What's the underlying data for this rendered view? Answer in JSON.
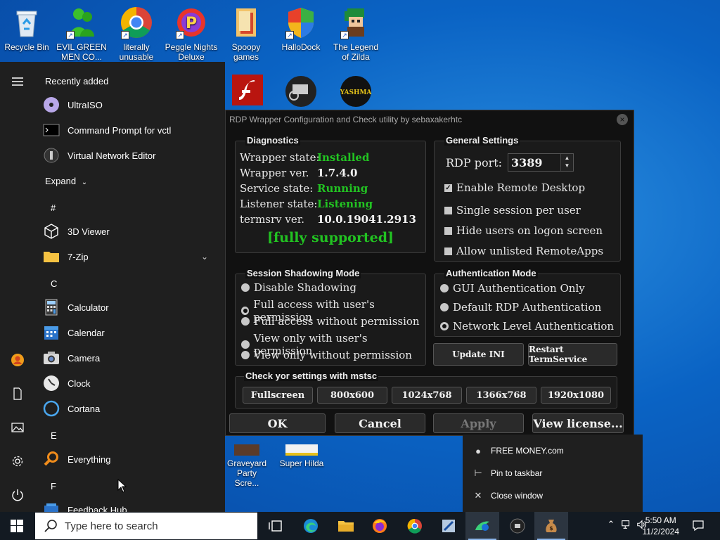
{
  "desktop": {
    "icons": [
      {
        "label": "Recycle Bin"
      },
      {
        "label": "EVIL GREEN MEN CO..."
      },
      {
        "label": "literally unusable"
      },
      {
        "label": "Peggle Nights Deluxe"
      },
      {
        "label": "Spoopy games"
      },
      {
        "label": "HalloDock"
      },
      {
        "label": "The Legend of Zilda"
      }
    ],
    "lower_icons": [
      {
        "label": "Graveyard Party Scre..."
      },
      {
        "label": "Super Hilda"
      }
    ]
  },
  "start_menu": {
    "recently_added_heading": "Recently added",
    "recent": [
      {
        "label": "UltraISO"
      },
      {
        "label": "Command Prompt for vctl"
      },
      {
        "label": "Virtual Network Editor"
      }
    ],
    "expand_label": "Expand",
    "letters": [
      "#",
      "C",
      "E",
      "F"
    ],
    "apps": [
      {
        "label": "3D Viewer"
      },
      {
        "label": "7-Zip"
      },
      {
        "label": "Calculator"
      },
      {
        "label": "Calendar"
      },
      {
        "label": "Camera"
      },
      {
        "label": "Clock"
      },
      {
        "label": "Cortana"
      },
      {
        "label": "Everything"
      },
      {
        "label": "Feedback Hub"
      }
    ]
  },
  "rdp": {
    "title": "RDP Wrapper Configuration and Check utility by sebaxakerhtc",
    "close_glyph": "×",
    "diagnostics": {
      "title": "Diagnostics",
      "rows": [
        {
          "label": "Wrapper state:",
          "value": "Installed"
        },
        {
          "label": "Wrapper ver.",
          "value": "1.7.4.0"
        },
        {
          "label": "Service state:",
          "value": "Running"
        },
        {
          "label": "Listener state:",
          "value": "Listening"
        },
        {
          "label": "termsrv ver.",
          "value": "10.0.19041.2913"
        }
      ],
      "support": "[fully supported]"
    },
    "general": {
      "title": "General Settings",
      "port_label": "RDP port:",
      "port_value": "3389",
      "options": [
        {
          "label": "Enable Remote Desktop",
          "checked": true
        },
        {
          "label": "Single session per user",
          "checked": false
        },
        {
          "label": "Hide users on logon screen",
          "checked": false
        },
        {
          "label": "Allow unlisted RemoteApps",
          "checked": false
        }
      ]
    },
    "shadowing": {
      "title": "Session Shadowing Mode",
      "options": [
        {
          "label": "Disable Shadowing",
          "selected": false
        },
        {
          "label": "Full access with user's permission",
          "selected": true
        },
        {
          "label": "Full access without permission",
          "selected": false
        },
        {
          "label": "View only with user's permission",
          "selected": false
        },
        {
          "label": "View only without permission",
          "selected": false
        }
      ]
    },
    "auth": {
      "title": "Authentication Mode",
      "options": [
        {
          "label": "GUI Authentication Only",
          "selected": false
        },
        {
          "label": "Default RDP Authentication",
          "selected": false
        },
        {
          "label": "Network Level Authentication",
          "selected": true
        }
      ]
    },
    "update_ini": "Update INI",
    "restart": "Restart TermService",
    "mstsc": {
      "title": "Check yor settings with mstsc",
      "buttons": [
        "Fullscreen",
        "800x600",
        "1024x768",
        "1366x768",
        "1920x1080"
      ]
    },
    "ok": "OK",
    "cancel": "Cancel",
    "apply": "Apply",
    "view_license": "View license..."
  },
  "context_menu": {
    "items": [
      {
        "label": "FREE MONEY.com",
        "icon": "money-bag-icon"
      },
      {
        "label": "Pin to taskbar",
        "icon": "pin-icon"
      },
      {
        "label": "Close window",
        "icon": "close-icon"
      }
    ]
  },
  "taskbar": {
    "search_placeholder": "Type here to search",
    "time": "5:50 AM",
    "date": "11/2/2024"
  }
}
